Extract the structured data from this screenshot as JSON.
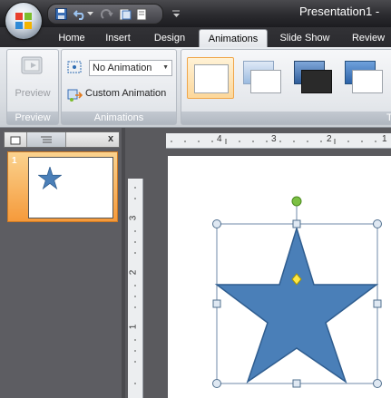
{
  "window": {
    "title": "Presentation1 -"
  },
  "tabs": [
    {
      "label": "Home",
      "active": false
    },
    {
      "label": "Insert",
      "active": false
    },
    {
      "label": "Design",
      "active": false
    },
    {
      "label": "Animations",
      "active": true
    },
    {
      "label": "Slide Show",
      "active": false
    },
    {
      "label": "Review",
      "active": false
    }
  ],
  "ribbon": {
    "preview": {
      "button_label": "Preview",
      "group_label": "Preview"
    },
    "animations": {
      "dropdown_value": "No Animation",
      "custom_label": "Custom Animation",
      "group_label": "Animations"
    },
    "transitions_group_label_partial": "T"
  },
  "panel": {
    "slide_number": "1",
    "close_glyph": "x"
  },
  "rulers": {
    "horizontal_labels": [
      "4",
      "3",
      "2",
      "1"
    ],
    "vertical_labels": [
      "3",
      "2",
      "1"
    ]
  },
  "colors": {
    "accent_orange": "#f59a3b",
    "shape_fill": "#4a7fb8",
    "shape_stroke": "#2f5d8f",
    "handle_green": "#7bc043",
    "handle_yellow": "#ffe845"
  },
  "icons": {
    "office_button": "office-logo-icon",
    "save": "save-icon",
    "undo": "undo-icon",
    "redo": "redo-icon",
    "preview": "preview-icon",
    "custom_animation": "custom-animation-icon"
  }
}
